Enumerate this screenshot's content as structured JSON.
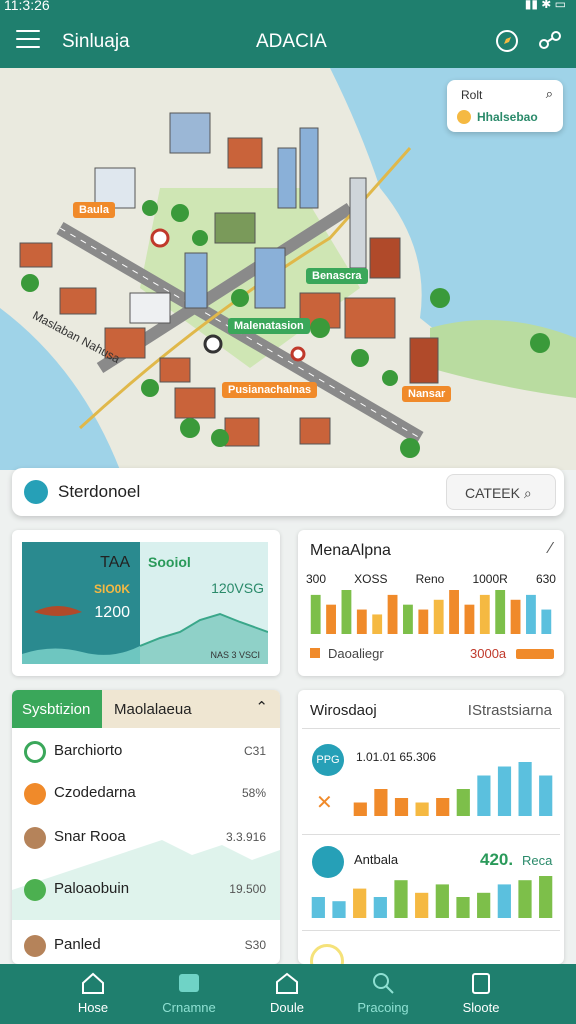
{
  "status": {
    "time": "11:3:26"
  },
  "header": {
    "app_name": "Sinluaja",
    "title": "ADACIA"
  },
  "map": {
    "labels": [
      {
        "text": "Baula",
        "style": "orange"
      },
      {
        "text": "Benascra",
        "style": "green"
      },
      {
        "text": "Malenatasion",
        "style": "green"
      },
      {
        "text": "Pusianachalnas",
        "style": "orange"
      },
      {
        "text": "Nansar",
        "style": "orange"
      },
      {
        "text": "Maslaban Nahusa",
        "style": "dark"
      }
    ],
    "card": {
      "line1": "Rolt",
      "line2": "Hhalsebao"
    }
  },
  "search": {
    "text": "Sterdonoel",
    "button": "CATEEK"
  },
  "stats_card": {
    "tag": "TAA",
    "left_label": "SIO0K",
    "left_value": "1200",
    "right_title": "Sooiol",
    "right_value": "120VSG",
    "right_foot": "NAS 3 VSCI"
  },
  "bar_card": {
    "title": "MenaAlpna",
    "headers": [
      "300",
      "XOSS",
      "Reno",
      "1000R",
      "630"
    ],
    "legend": "Daoaliegr",
    "legend_value": "3000a",
    "values": [
      8,
      6,
      9,
      5,
      4,
      8,
      6,
      5,
      7,
      9,
      6,
      8,
      9,
      7,
      8,
      5
    ],
    "colors": [
      "#7dbf4a",
      "#f08a2a",
      "#7dbf4a",
      "#f08a2a",
      "#f5b942",
      "#f08a2a",
      "#7dbf4a",
      "#f08a2a",
      "#f5b942",
      "#f08a2a",
      "#f08a2a",
      "#f5b942",
      "#7dbf4a",
      "#f08a2a",
      "#5bc0de",
      "#5bc0de"
    ]
  },
  "list_card": {
    "tab_active": "Sysbtizion",
    "tab_other": "Maolalaeua",
    "items": [
      {
        "name": "Barchiorto",
        "value": "C31",
        "color": "#3aa75a",
        "ring": true
      },
      {
        "name": "Czodedarna",
        "value": "58%",
        "color": "#f08a2a",
        "ring": false
      },
      {
        "name": "Snar Rooa",
        "value": "3.3.916",
        "color": "#b5835a",
        "ring": false
      },
      {
        "name": "Paloaobuin",
        "value": "19.500",
        "color": "#4cb050",
        "ring": false
      },
      {
        "name": "Panled",
        "value": "S30",
        "color": "#b5835a",
        "ring": false
      }
    ]
  },
  "right_card": {
    "title": "Wirosdaoj",
    "subtitle": "IStrastsiarna",
    "row1_badge": "PPG",
    "row1_value": "1.01.01 65.306",
    "row1_bars": [
      3,
      6,
      4,
      3,
      4,
      6,
      9,
      11,
      12,
      9
    ],
    "row1_colors": [
      "#f08a2a",
      "#f08a2a",
      "#f08a2a",
      "#f5b942",
      "#f08a2a",
      "#7dbf4a",
      "#5bc0de",
      "#5bc0de",
      "#5bc0de",
      "#5bc0de"
    ],
    "row2_label": "Antbala",
    "row2_value": "420.",
    "row2_unit": "Reca",
    "row2_bars": [
      5,
      4,
      7,
      5,
      9,
      6,
      8,
      5,
      6,
      8,
      9,
      10
    ],
    "row2_colors": [
      "#5bc0de",
      "#5bc0de",
      "#f5b942",
      "#5bc0de",
      "#7dbf4a",
      "#f5b942",
      "#7dbf4a",
      "#7dbf4a",
      "#7dbf4a",
      "#5bc0de",
      "#7dbf4a",
      "#7dbf4a"
    ]
  },
  "nav": [
    "Hose",
    "Crnamne",
    "Doule",
    "Pracoing",
    "Sloote"
  ]
}
